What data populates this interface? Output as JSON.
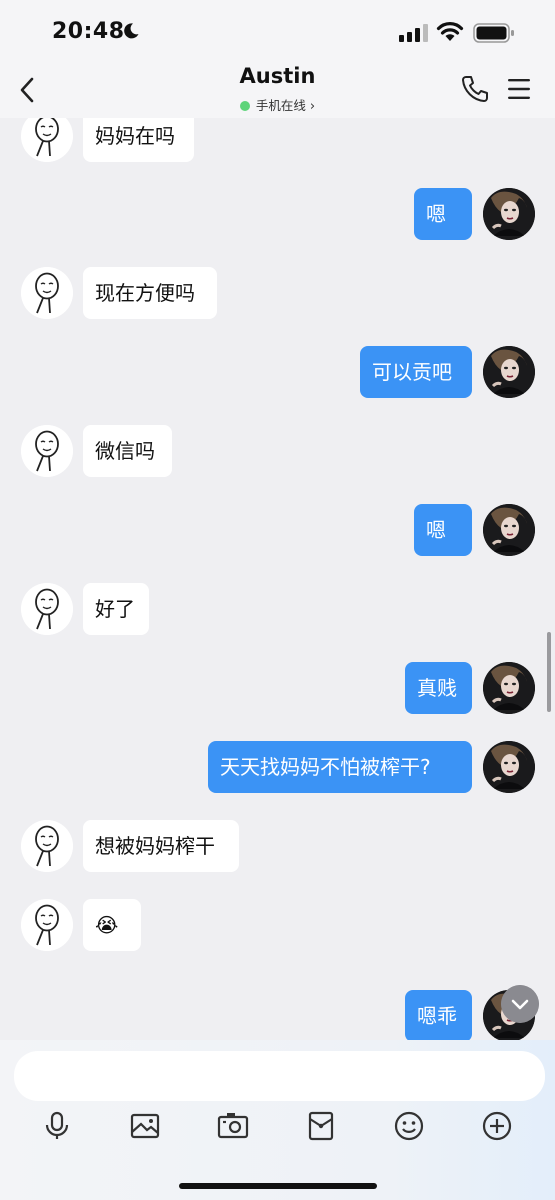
{
  "status_bar": {
    "time": "20:48"
  },
  "header": {
    "title": "Austin",
    "status": "手机在线",
    "status_color": "#5ed47a"
  },
  "colors": {
    "self_bubble": "#3b93f5",
    "peer_bubble": "#ffffff",
    "background": "#efeff2"
  },
  "messages": [
    {
      "side": "peer",
      "text": "妈妈在吗"
    },
    {
      "side": "self",
      "text": "嗯"
    },
    {
      "side": "peer",
      "text": "现在方便吗"
    },
    {
      "side": "self",
      "text": "可以贡吧"
    },
    {
      "side": "peer",
      "text": "微信吗"
    },
    {
      "side": "self",
      "text": "嗯"
    },
    {
      "side": "peer",
      "text": "好了"
    },
    {
      "side": "self",
      "text": "真贱"
    },
    {
      "side": "self",
      "text": "天天找妈妈不怕被榨干?"
    },
    {
      "side": "peer",
      "text": "想被妈妈榨干"
    },
    {
      "side": "peer",
      "text": "😭"
    },
    {
      "side": "self",
      "text": "嗯乖"
    }
  ],
  "composer": {
    "placeholder": ""
  },
  "toolbar": [
    "microphone-icon",
    "image-icon",
    "camera-icon",
    "red-packet-icon",
    "emoji-icon",
    "plus-icon"
  ]
}
